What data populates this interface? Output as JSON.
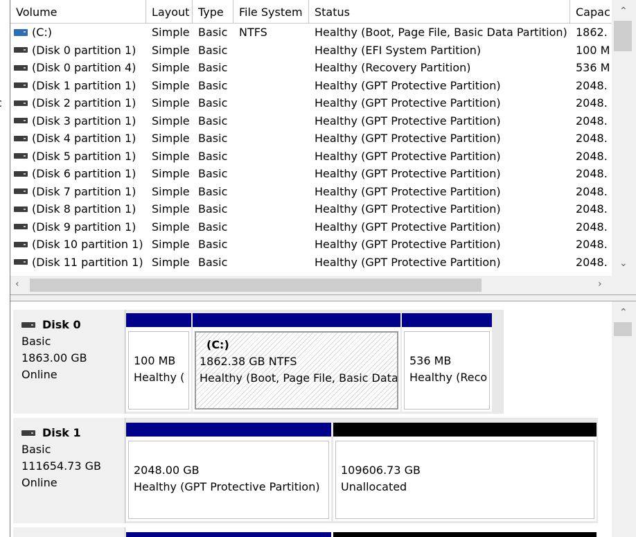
{
  "columns": [
    "Volume",
    "Layout",
    "Type",
    "File System",
    "Status",
    "Capac"
  ],
  "edge_fragments": [
    ")",
    "c"
  ],
  "volumes": [
    {
      "volume": "(C:)",
      "layout": "Simple",
      "type": "Basic",
      "fs": "NTFS",
      "status": "Healthy (Boot, Page File, Basic Data Partition)",
      "capacity": "1862.",
      "system": true
    },
    {
      "volume": "(Disk 0 partition 1)",
      "layout": "Simple",
      "type": "Basic",
      "fs": "",
      "status": "Healthy (EFI System Partition)",
      "capacity": "100 M"
    },
    {
      "volume": "(Disk 0 partition 4)",
      "layout": "Simple",
      "type": "Basic",
      "fs": "",
      "status": "Healthy (Recovery Partition)",
      "capacity": "536 M"
    },
    {
      "volume": "(Disk 1 partition 1)",
      "layout": "Simple",
      "type": "Basic",
      "fs": "",
      "status": "Healthy (GPT Protective Partition)",
      "capacity": "2048."
    },
    {
      "volume": "(Disk 2 partition 1)",
      "layout": "Simple",
      "type": "Basic",
      "fs": "",
      "status": "Healthy (GPT Protective Partition)",
      "capacity": "2048."
    },
    {
      "volume": "(Disk 3 partition 1)",
      "layout": "Simple",
      "type": "Basic",
      "fs": "",
      "status": "Healthy (GPT Protective Partition)",
      "capacity": "2048."
    },
    {
      "volume": "(Disk 4 partition 1)",
      "layout": "Simple",
      "type": "Basic",
      "fs": "",
      "status": "Healthy (GPT Protective Partition)",
      "capacity": "2048."
    },
    {
      "volume": "(Disk 5 partition 1)",
      "layout": "Simple",
      "type": "Basic",
      "fs": "",
      "status": "Healthy (GPT Protective Partition)",
      "capacity": "2048."
    },
    {
      "volume": "(Disk 6 partition 1)",
      "layout": "Simple",
      "type": "Basic",
      "fs": "",
      "status": "Healthy (GPT Protective Partition)",
      "capacity": "2048."
    },
    {
      "volume": "(Disk 7 partition 1)",
      "layout": "Simple",
      "type": "Basic",
      "fs": "",
      "status": "Healthy (GPT Protective Partition)",
      "capacity": "2048."
    },
    {
      "volume": "(Disk 8 partition 1)",
      "layout": "Simple",
      "type": "Basic",
      "fs": "",
      "status": "Healthy (GPT Protective Partition)",
      "capacity": "2048."
    },
    {
      "volume": "(Disk 9 partition 1)",
      "layout": "Simple",
      "type": "Basic",
      "fs": "",
      "status": "Healthy (GPT Protective Partition)",
      "capacity": "2048."
    },
    {
      "volume": "(Disk 10 partition 1)",
      "layout": "Simple",
      "type": "Basic",
      "fs": "",
      "status": "Healthy (GPT Protective Partition)",
      "capacity": "2048."
    },
    {
      "volume": "(Disk 11 partition 1)",
      "layout": "Simple",
      "type": "Basic",
      "fs": "",
      "status": "Healthy (GPT Protective Partition)",
      "capacity": "2048."
    }
  ],
  "disks": [
    {
      "name": "Disk 0",
      "type": "Basic",
      "size": "1863.00 GB",
      "state": "Online",
      "partitions": [
        {
          "label": "",
          "line1": "100 MB",
          "line2": "Healthy (",
          "kind": "primary"
        },
        {
          "label": "(C:)",
          "line1": "1862.38 GB NTFS",
          "line2": "Healthy (Boot, Page File, Basic Data",
          "kind": "selected"
        },
        {
          "label": "",
          "line1": "536 MB",
          "line2": "Healthy (Reco",
          "kind": "primary"
        }
      ]
    },
    {
      "name": "Disk 1",
      "type": "Basic",
      "size": "111654.73 GB",
      "state": "Online",
      "partitions": [
        {
          "label": "",
          "line1": "2048.00 GB",
          "line2": "Healthy (GPT Protective Partition)",
          "kind": "primary"
        },
        {
          "label": "",
          "line1": "109606.73 GB",
          "line2": "Unallocated",
          "kind": "unallocated"
        }
      ]
    }
  ],
  "colors": {
    "primary": "#00008b",
    "unallocated": "#000000",
    "system_icon": "#2c6fb5"
  },
  "icons": {
    "disk": "disk-drive-icon",
    "scroll_up": "chevron-up-icon",
    "scroll_down": "chevron-down-icon",
    "scroll_left": "chevron-left-icon",
    "scroll_right": "chevron-right-icon"
  }
}
